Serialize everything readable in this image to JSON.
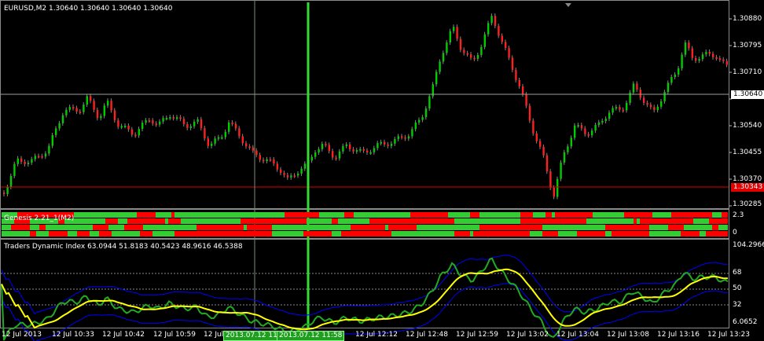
{
  "main_chart": {
    "title": "EURUSD,M2  1.30640 1.30640 1.30640 1.30640",
    "price_levels": [
      "1.30880",
      "1.30795",
      "1.30710",
      "1.30540",
      "1.30455",
      "1.30370",
      "1.30285"
    ],
    "current_price": "1.30640",
    "red_line_price": "1.30343",
    "bull_color": "#00cc00",
    "bear_color": "#ff2020"
  },
  "genesis": {
    "title": "Genesis 2.21_1(M2)",
    "scale": [
      "2.3",
      "0"
    ],
    "green": "#33cc33",
    "red": "#ff0000"
  },
  "tdi": {
    "title": "Traders Dynamic Index 63.0944 51.8183 40.5423 48.9616 46.5388",
    "scale_top": "104.2966",
    "levels": [
      "68",
      "50",
      "32"
    ],
    "scale_bottom": "6.0652"
  },
  "time_axis": {
    "labels": [
      "12 Jul 2013",
      "12 Jul 10:33",
      "12 Jul 10:42",
      "12 Jul 10:59",
      "12 Jul 1",
      "12 Jul 12:12",
      "12 Jul 12:48",
      "12 Jul 12:59",
      "12 Jul 13:02",
      "12 Jul 13:04",
      "12 Jul 13:08",
      "12 Jul 13:16",
      "12 Jul 13:23"
    ],
    "cursor_label_1": "2013.07.12 11:",
    "cursor_label_2": "2013.07.12 11:58"
  }
}
